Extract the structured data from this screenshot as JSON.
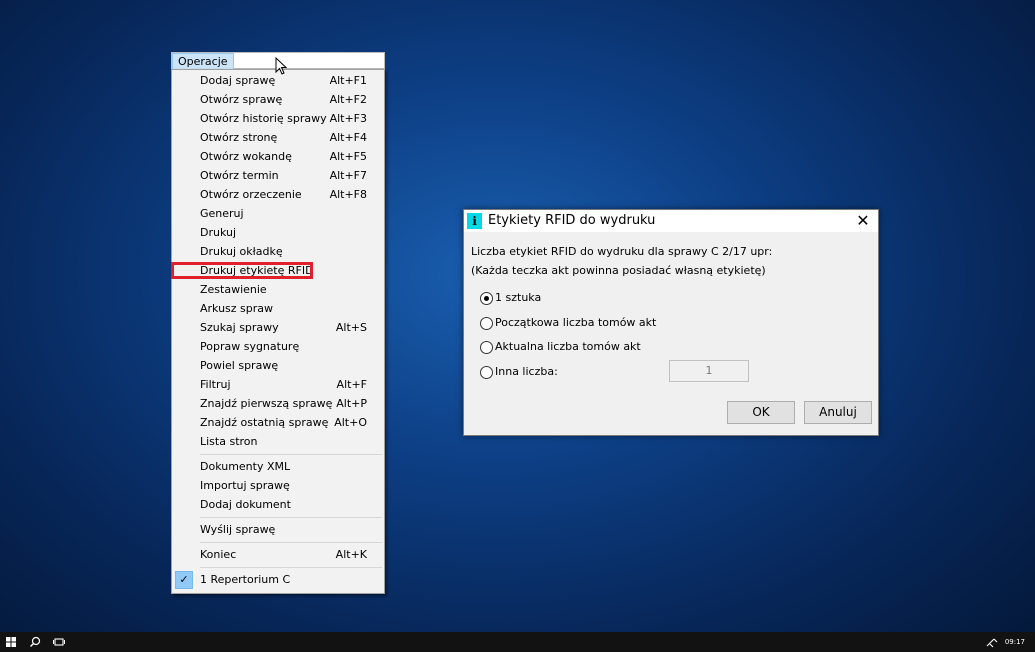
{
  "menu": {
    "title": "Operacje",
    "items": [
      {
        "label": "Dodaj sprawę",
        "shortcut": "Alt+F1"
      },
      {
        "label": "Otwórz sprawę",
        "shortcut": "Alt+F2"
      },
      {
        "label": "Otwórz historię sprawy",
        "shortcut": "Alt+F3"
      },
      {
        "label": "Otwórz stronę",
        "shortcut": "Alt+F4"
      },
      {
        "label": "Otwórz wokandę",
        "shortcut": "Alt+F5"
      },
      {
        "label": "Otwórz termin",
        "shortcut": "Alt+F7"
      },
      {
        "label": "Otwórz orzeczenie",
        "shortcut": "Alt+F8"
      },
      {
        "label": "Generuj",
        "shortcut": ""
      },
      {
        "label": "Drukuj",
        "shortcut": ""
      },
      {
        "label": "Drukuj okładkę",
        "shortcut": ""
      },
      {
        "label": "Drukuj etykietę RFID",
        "shortcut": ""
      },
      {
        "label": "Zestawienie",
        "shortcut": ""
      },
      {
        "label": "Arkusz spraw",
        "shortcut": ""
      },
      {
        "label": "Szukaj sprawy",
        "shortcut": "Alt+S"
      },
      {
        "label": "Popraw sygnaturę",
        "shortcut": ""
      },
      {
        "label": "Powiel sprawę",
        "shortcut": ""
      },
      {
        "label": "Filtruj",
        "shortcut": "Alt+F"
      },
      {
        "label": "Znajdź pierwszą sprawę",
        "shortcut": "Alt+P"
      },
      {
        "label": "Znajdź ostatnią sprawę",
        "shortcut": "Alt+O"
      },
      {
        "label": "Lista stron",
        "shortcut": ""
      },
      {
        "label": "Dokumenty XML",
        "shortcut": ""
      },
      {
        "label": "Importuj sprawę",
        "shortcut": ""
      },
      {
        "label": "Dodaj dokument",
        "shortcut": ""
      },
      {
        "label": "Wyślij sprawę",
        "shortcut": ""
      },
      {
        "label": "Koniec",
        "shortcut": "Alt+K"
      },
      {
        "label": "1 Repertorium C",
        "shortcut": ""
      }
    ],
    "check_glyph": "✓"
  },
  "dialog": {
    "title": "Etykiety RFID do wydruku",
    "close_glyph": "✕",
    "message_line1": "Liczba etykiet RFID do wydruku dla sprawy  C 2/17 upr:",
    "message_line2": "(Każda teczka akt powinna posiadać własną etykietę)",
    "options": [
      {
        "label": "1 sztuka",
        "selected": true
      },
      {
        "label": "Początkowa liczba tomów akt",
        "selected": false
      },
      {
        "label": "Aktualna liczba tomów akt",
        "selected": false
      },
      {
        "label": "Inna liczba:",
        "selected": false
      }
    ],
    "other_value": "1",
    "ok_label": "OK",
    "cancel_label": "Anuluj"
  },
  "taskbar": {
    "time": "09:17"
  },
  "colors": {
    "highlight_border": "#e0202a",
    "menu_title_bg": "#cce4f7",
    "app_icon": "#00d9e6"
  },
  "icons": [
    "windows-start-icon",
    "search-icon",
    "task-view-icon",
    "network-icon",
    "info-icon",
    "close-icon",
    "checkmark-icon",
    "mouse-cursor-icon"
  ]
}
